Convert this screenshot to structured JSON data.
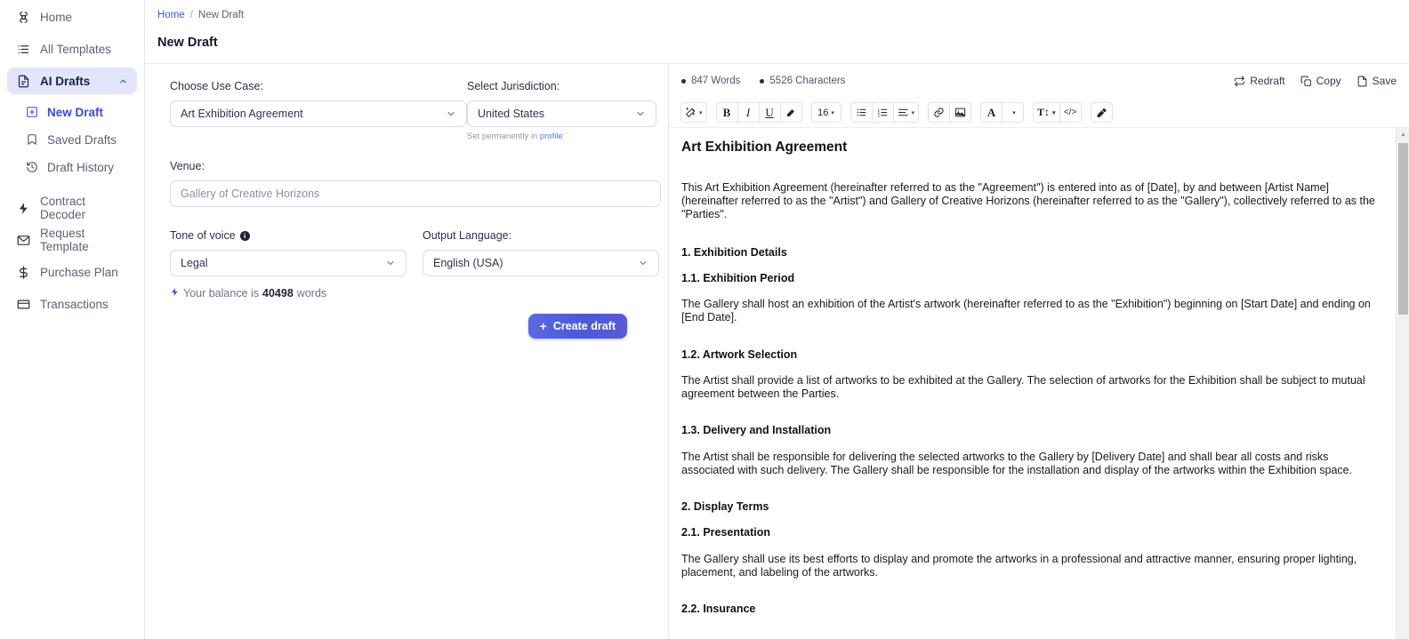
{
  "sidebar": {
    "items": [
      {
        "label": "Home",
        "icon": "home-grid-icon"
      },
      {
        "label": "All Templates",
        "icon": "list-icon"
      },
      {
        "label": "AI Drafts",
        "icon": "document-icon",
        "active": true,
        "chevron": "chevron-up-icon"
      }
    ],
    "sub_items": [
      {
        "label": "New Draft",
        "icon": "plus-square-icon",
        "current": true
      },
      {
        "label": "Saved Drafts",
        "icon": "bookmark-icon"
      },
      {
        "label": "Draft History",
        "icon": "history-clock-icon"
      }
    ],
    "lower_items": [
      {
        "label": "Contract Decoder",
        "icon": "bolt-icon"
      },
      {
        "label": "Request Template",
        "icon": "envelope-icon"
      },
      {
        "label": "Purchase Plan",
        "icon": "dollar-icon"
      },
      {
        "label": "Transactions",
        "icon": "credit-card-icon"
      }
    ]
  },
  "breadcrumb": {
    "home": "Home",
    "separator": "/",
    "current": "New Draft"
  },
  "page": {
    "title": "New Draft"
  },
  "form": {
    "use_case": {
      "label": "Choose Use Case:",
      "value": "Art Exhibition Agreement"
    },
    "jurisdiction": {
      "label": "Select Jurisdiction:",
      "value": "United States",
      "hint_prefix": "Set permanently in",
      "hint_link": "profile"
    },
    "venue": {
      "label": "Venue:",
      "placeholder": "Gallery of Creative Horizons",
      "value": ""
    },
    "tone": {
      "label": "Tone of voice",
      "value": "Legal",
      "info": "i"
    },
    "language": {
      "label": "Output Language:",
      "value": "English (USA)"
    },
    "balance": {
      "prefix": "Your balance is",
      "amount": "40498",
      "suffix": "words"
    },
    "create_button": "Create draft"
  },
  "editor": {
    "stats": [
      {
        "value": "847 Words"
      },
      {
        "value": "5526 Characters"
      }
    ],
    "actions": [
      {
        "label": "Redraft",
        "icon": "refresh-icon"
      },
      {
        "label": "Copy",
        "icon": "copy-icon"
      },
      {
        "label": "Save",
        "icon": "save-file-icon"
      }
    ],
    "toolbar": {
      "magic": {
        "icon": "magic-wand-icon",
        "caret": "▾"
      },
      "bold": "B",
      "italic": "I",
      "underline": "U",
      "highlight": {
        "icon": "highlighter-icon"
      },
      "font_size": "16",
      "bullet_list": {
        "icon": "bullet-list-icon"
      },
      "ordered_list": {
        "icon": "ordered-list-icon"
      },
      "align": {
        "icon": "align-icon",
        "caret": "▾"
      },
      "link": {
        "icon": "link-icon"
      },
      "image": {
        "icon": "image-icon"
      },
      "font_color": "A",
      "line_height": "T↕",
      "code": "</>",
      "eraser": {
        "icon": "eraser-icon"
      }
    }
  },
  "document": {
    "title": "Art Exhibition Agreement",
    "intro": "This Art Exhibition Agreement (hereinafter referred to as the \"Agreement\") is entered into as of [Date], by and between [Artist Name] (hereinafter referred to as the \"Artist\") and Gallery of Creative Horizons (hereinafter referred to as the \"Gallery\"), collectively referred to as the \"Parties\".",
    "h_1": "1. Exhibition Details",
    "h_1_1": "1.1. Exhibition Period",
    "p_1_1": "The Gallery shall host an exhibition of the Artist's artwork (hereinafter referred to as the \"Exhibition\") beginning on [Start Date] and ending on [End Date].",
    "h_1_2": "1.2. Artwork Selection",
    "p_1_2": "The Artist shall provide a list of artworks to be exhibited at the Gallery. The selection of artworks for the Exhibition shall be subject to mutual agreement between the Parties.",
    "h_1_3": "1.3. Delivery and Installation",
    "p_1_3": "The Artist shall be responsible for delivering the selected artworks to the Gallery by [Delivery Date] and shall bear all costs and risks associated with such delivery. The Gallery shall be responsible for the installation and display of the artworks within the Exhibition space.",
    "h_2": "2. Display Terms",
    "h_2_1": "2.1. Presentation",
    "p_2_1": "The Gallery shall use its best efforts to display and promote the artworks in a professional and attractive manner, ensuring proper lighting, placement, and labeling of the artworks.",
    "h_2_2": "2.2. Insurance"
  },
  "colors": {
    "accent": "#3b4bd8",
    "sidebar_active_bg": "#e3e5fb",
    "link": "#3b5bdb",
    "button_gradient_start": "#5b6ae0",
    "button_gradient_end": "#5c59d6"
  }
}
